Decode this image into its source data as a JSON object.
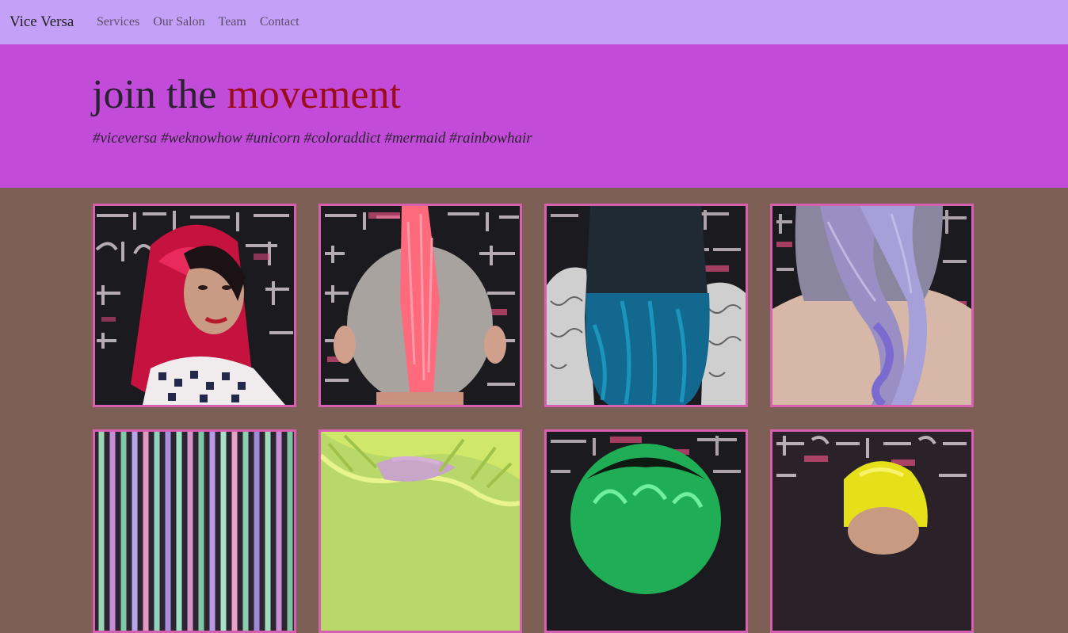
{
  "nav": {
    "brand": "Vice Versa",
    "links": [
      "Services",
      "Our Salon",
      "Team",
      "Contact"
    ]
  },
  "hero": {
    "title_plain": "join the ",
    "title_accent": "movement",
    "tags": "#viceversa #weknowhow #unicorn #coloraddict #mermaid #rainbowhair"
  },
  "colors": {
    "navbar": "#c5a0f8",
    "hero": "#c24cd9",
    "page": "#7e5f55",
    "accent": "#9c0c1a",
    "tile_border": "#d65fb0"
  },
  "gallery": {
    "photos": [
      {
        "name": "pink-hair-woman-photo",
        "icon": "portrait-photo"
      },
      {
        "name": "pink-mohawk-photo",
        "icon": "mohawk-photo"
      },
      {
        "name": "blue-ombre-hair-photo",
        "icon": "hair-back-photo"
      },
      {
        "name": "lavender-braid-photo",
        "icon": "hair-back-photo"
      },
      {
        "name": "pastel-strands-photo",
        "icon": "strands-photo"
      },
      {
        "name": "neon-green-pastel-hair-photo",
        "icon": "hair-top-photo"
      },
      {
        "name": "green-hair-photo",
        "icon": "hair-top-photo"
      },
      {
        "name": "yellow-hair-photo",
        "icon": "hair-top-photo"
      }
    ]
  }
}
